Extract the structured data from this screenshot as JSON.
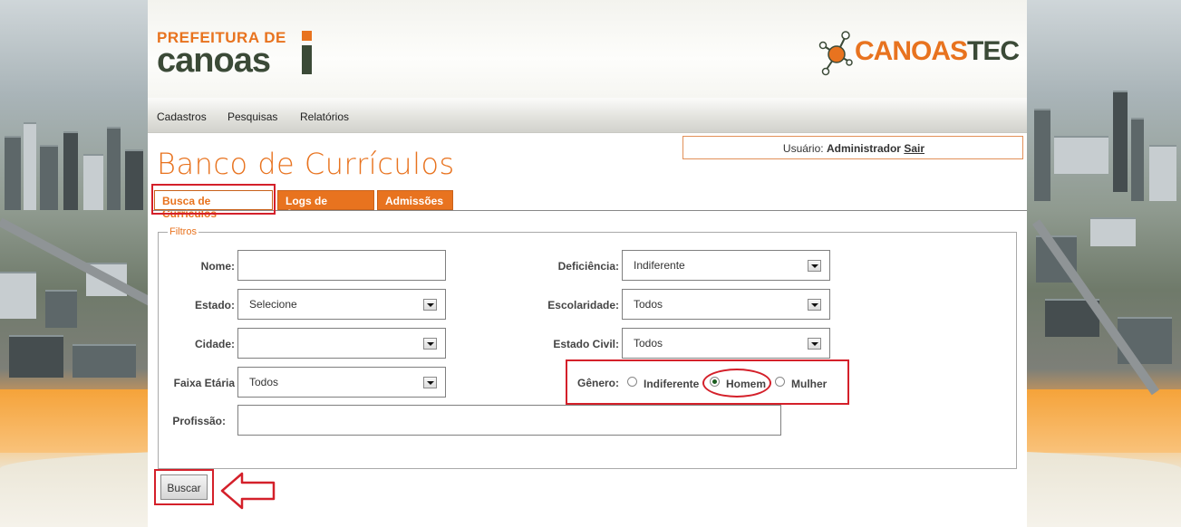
{
  "brand": {
    "prefeitura_line1": "PREFEITURA DE",
    "prefeitura_line2": "canoas",
    "canoastec_part1": "CANOAS",
    "canoastec_part2": "TEC"
  },
  "nav": {
    "items": [
      "Cadastros",
      "Pesquisas",
      "Relatórios"
    ]
  },
  "user": {
    "label": "Usuário:",
    "name": "Administrador",
    "logout": "Sair"
  },
  "page_title": "Banco de Currículos",
  "tabs": [
    {
      "label": "Busca de Curriculos",
      "active": true
    },
    {
      "label": "Logs de Acesso",
      "active": false
    },
    {
      "label": "Admissões",
      "active": false
    }
  ],
  "filters": {
    "legend": "Filtros",
    "nome": {
      "label": "Nome:",
      "value": ""
    },
    "estado": {
      "label": "Estado:",
      "value": "Selecione"
    },
    "cidade": {
      "label": "Cidade:",
      "value": ""
    },
    "faixa_etaria": {
      "label": "Faixa Etária",
      "value": "Todos"
    },
    "profissao": {
      "label": "Profissão:",
      "value": ""
    },
    "deficiencia": {
      "label": "Deficiência:",
      "value": "Indiferente"
    },
    "escolaridade": {
      "label": "Escolaridade:",
      "value": "Todos"
    },
    "estado_civil": {
      "label": "Estado Civil:",
      "value": "Todos"
    },
    "genero": {
      "label": "Gênero:",
      "options": [
        "Indiferente",
        "Homem",
        "Mulher"
      ],
      "selected": "Homem"
    }
  },
  "search_button": "Buscar",
  "colors": {
    "accent": "#e8731f",
    "dark_green": "#3b4a37",
    "highlight": "#d4202a"
  }
}
